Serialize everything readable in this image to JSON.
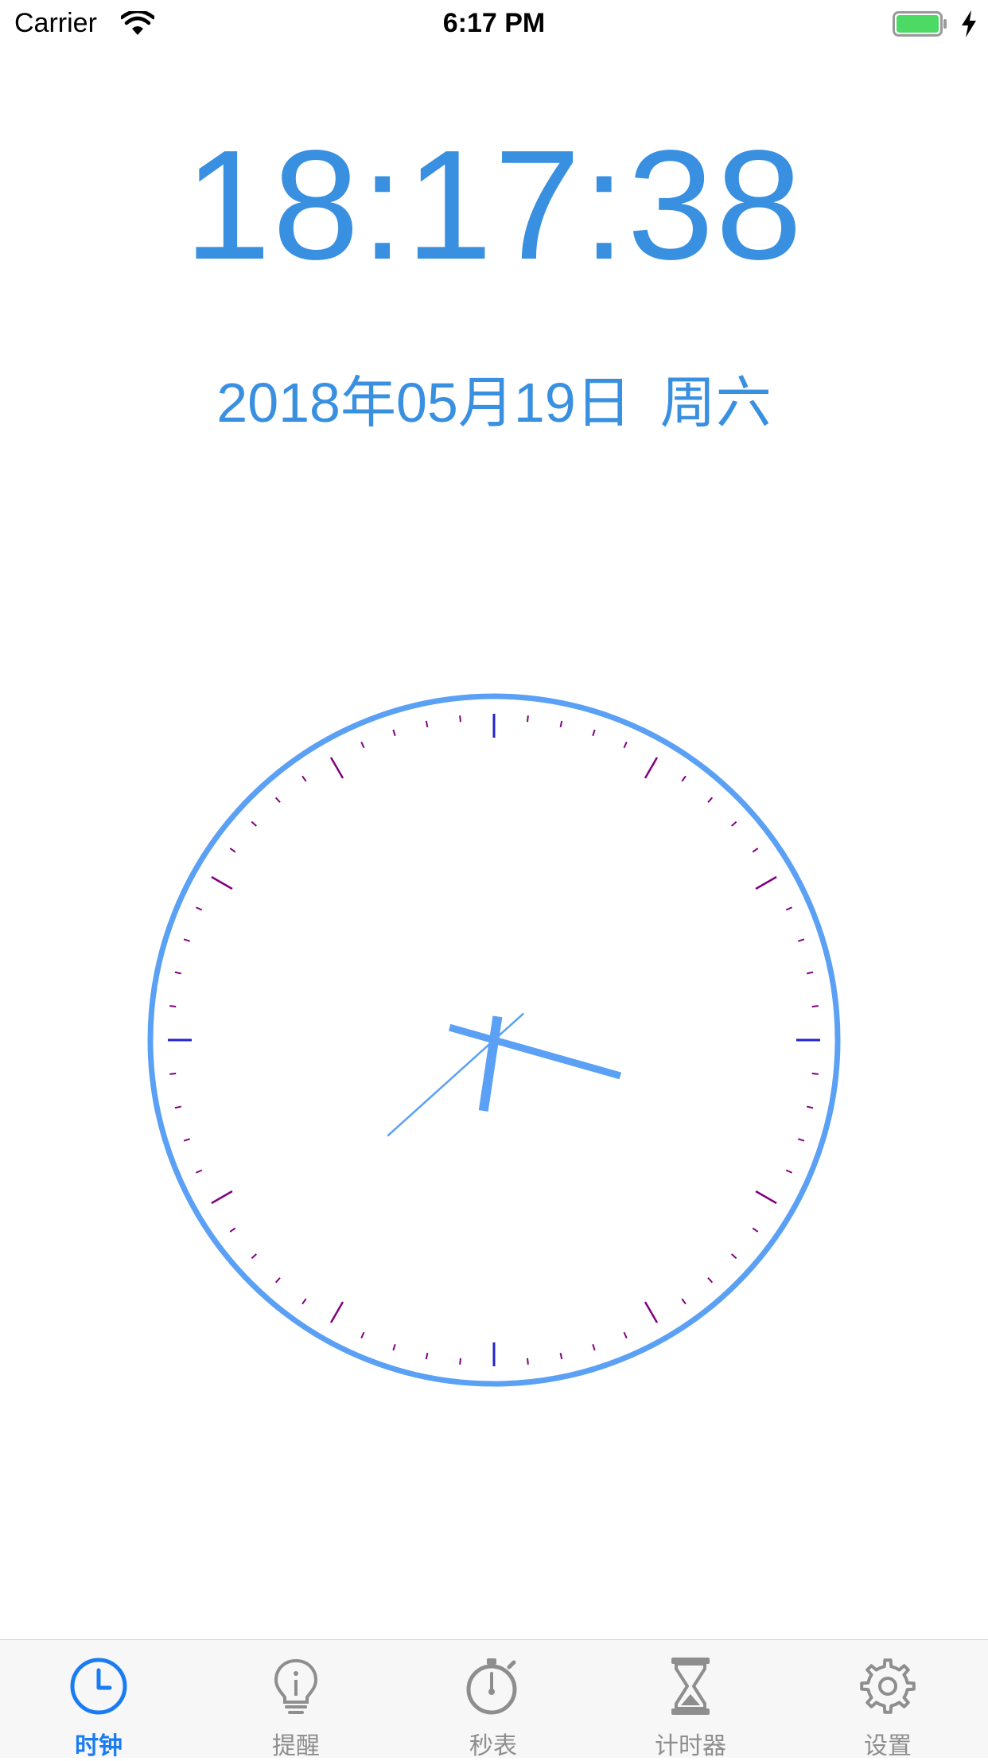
{
  "status_bar": {
    "carrier": "Carrier",
    "time": "6:17 PM",
    "battery_color": "#4cd964"
  },
  "clock": {
    "digital_time": "18:17:38",
    "date": "2018年05月19日",
    "weekday": "周六",
    "analog": {
      "hours": 18,
      "minutes": 17,
      "seconds": 38
    },
    "colors": {
      "ring": "#5aa0f5",
      "hands": "#5aa0f5",
      "major_ticks": "#2222cc",
      "hour_ticks": "#800080",
      "minute_ticks": "#800080"
    }
  },
  "tab_bar": {
    "active_color": "#1a7cf5",
    "inactive_color": "#8e8e8e",
    "items": [
      {
        "label": "时钟",
        "icon": "clock-icon",
        "active": true
      },
      {
        "label": "提醒",
        "icon": "lightbulb-icon",
        "active": false
      },
      {
        "label": "秒表",
        "icon": "stopwatch-icon",
        "active": false
      },
      {
        "label": "计时器",
        "icon": "hourglass-icon",
        "active": false
      },
      {
        "label": "设置",
        "icon": "gear-icon",
        "active": false
      }
    ]
  }
}
